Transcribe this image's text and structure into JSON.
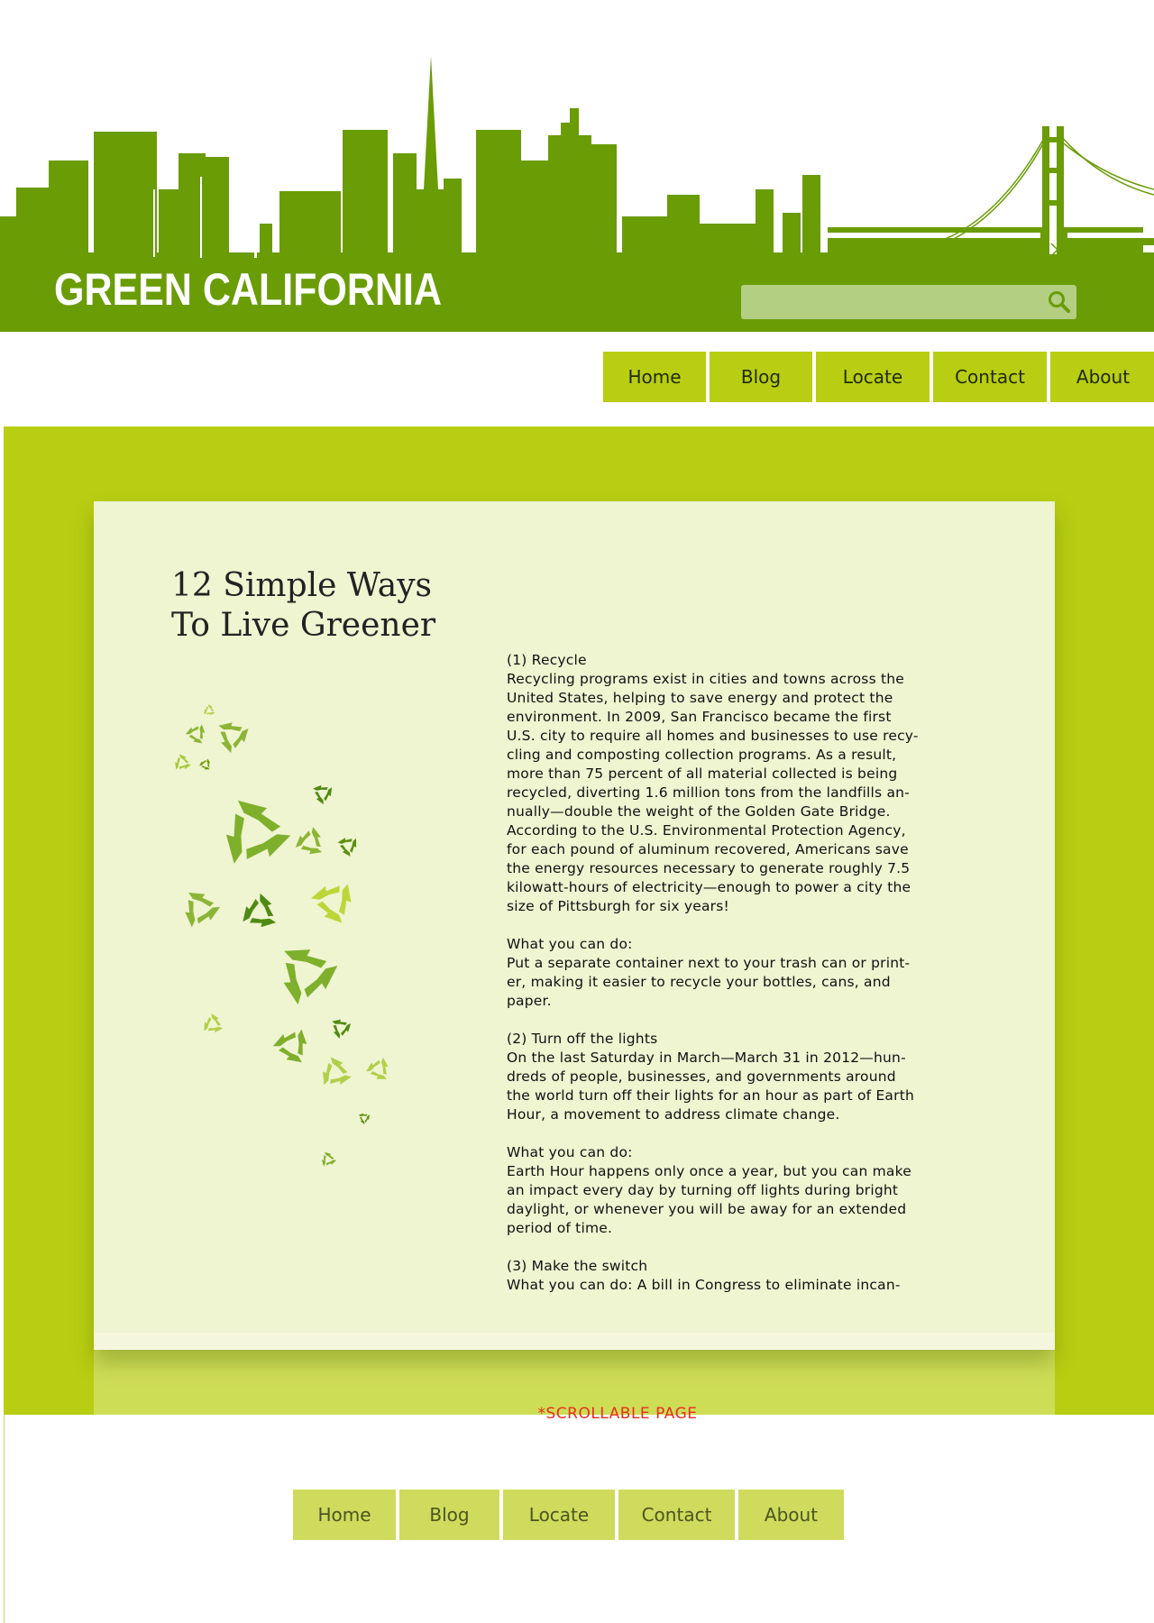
{
  "site": {
    "title": "GREEN CALIFORNIA",
    "brand_color": "#6a9c06",
    "accent_color": "#b8ce12"
  },
  "search": {
    "placeholder": "",
    "value": "",
    "icon": "search-icon"
  },
  "nav_top": [
    {
      "label": "Home"
    },
    {
      "label": "Blog"
    },
    {
      "label": "Locate"
    },
    {
      "label": "Contact"
    },
    {
      "label": "About"
    }
  ],
  "nav_bottom": [
    {
      "label": "Home"
    },
    {
      "label": "Blog"
    },
    {
      "label": "Locate"
    },
    {
      "label": "Contact"
    },
    {
      "label": "About"
    }
  ],
  "article": {
    "title_line1": "12 Simple Ways",
    "title_line2": "To Live Greener",
    "body": "(1) Recycle\nRecycling programs exist in cities and towns across the\nUnited States, helping to save energy and protect the\nenvironment. In 2009, San Francisco became the first\nU.S. city to require all homes and businesses to use recy-\ncling and composting collection programs. As a result,\nmore than 75 percent of all material collected is being\nrecycled, diverting 1.6 million tons from the landfills an-\nnually—double the weight of the Golden Gate Bridge.\nAccording to the U.S. Environmental Protection Agency,\nfor each pound of aluminum recovered, Americans save\nthe energy resources necessary to generate roughly 7.5\nkilowatt-hours of electricity—enough to power a city the\nsize of Pittsburgh for six years!\n\nWhat you can do:\nPut a separate container next to your trash can or print-\ner, making it easier to recycle your bottles, cans, and\npaper.\n\n(2) Turn off the lights\nOn the last Saturday in March—March 31 in 2012—hun-\ndreds of people, businesses, and governments around\nthe world turn off their lights for an hour as part of Earth\nHour, a movement to address climate change.\n\nWhat you can do:\nEarth Hour happens only once a year, but you can make\nan impact every day by turning off lights during bright\ndaylight, or whenever you will be away for an extended\nperiod of time.\n\n(3) Make the switch\nWhat you can do: A bill in Congress to eliminate incan-"
  },
  "note": {
    "text": "*SCROLLABLE PAGE",
    "color": "#e53020"
  }
}
